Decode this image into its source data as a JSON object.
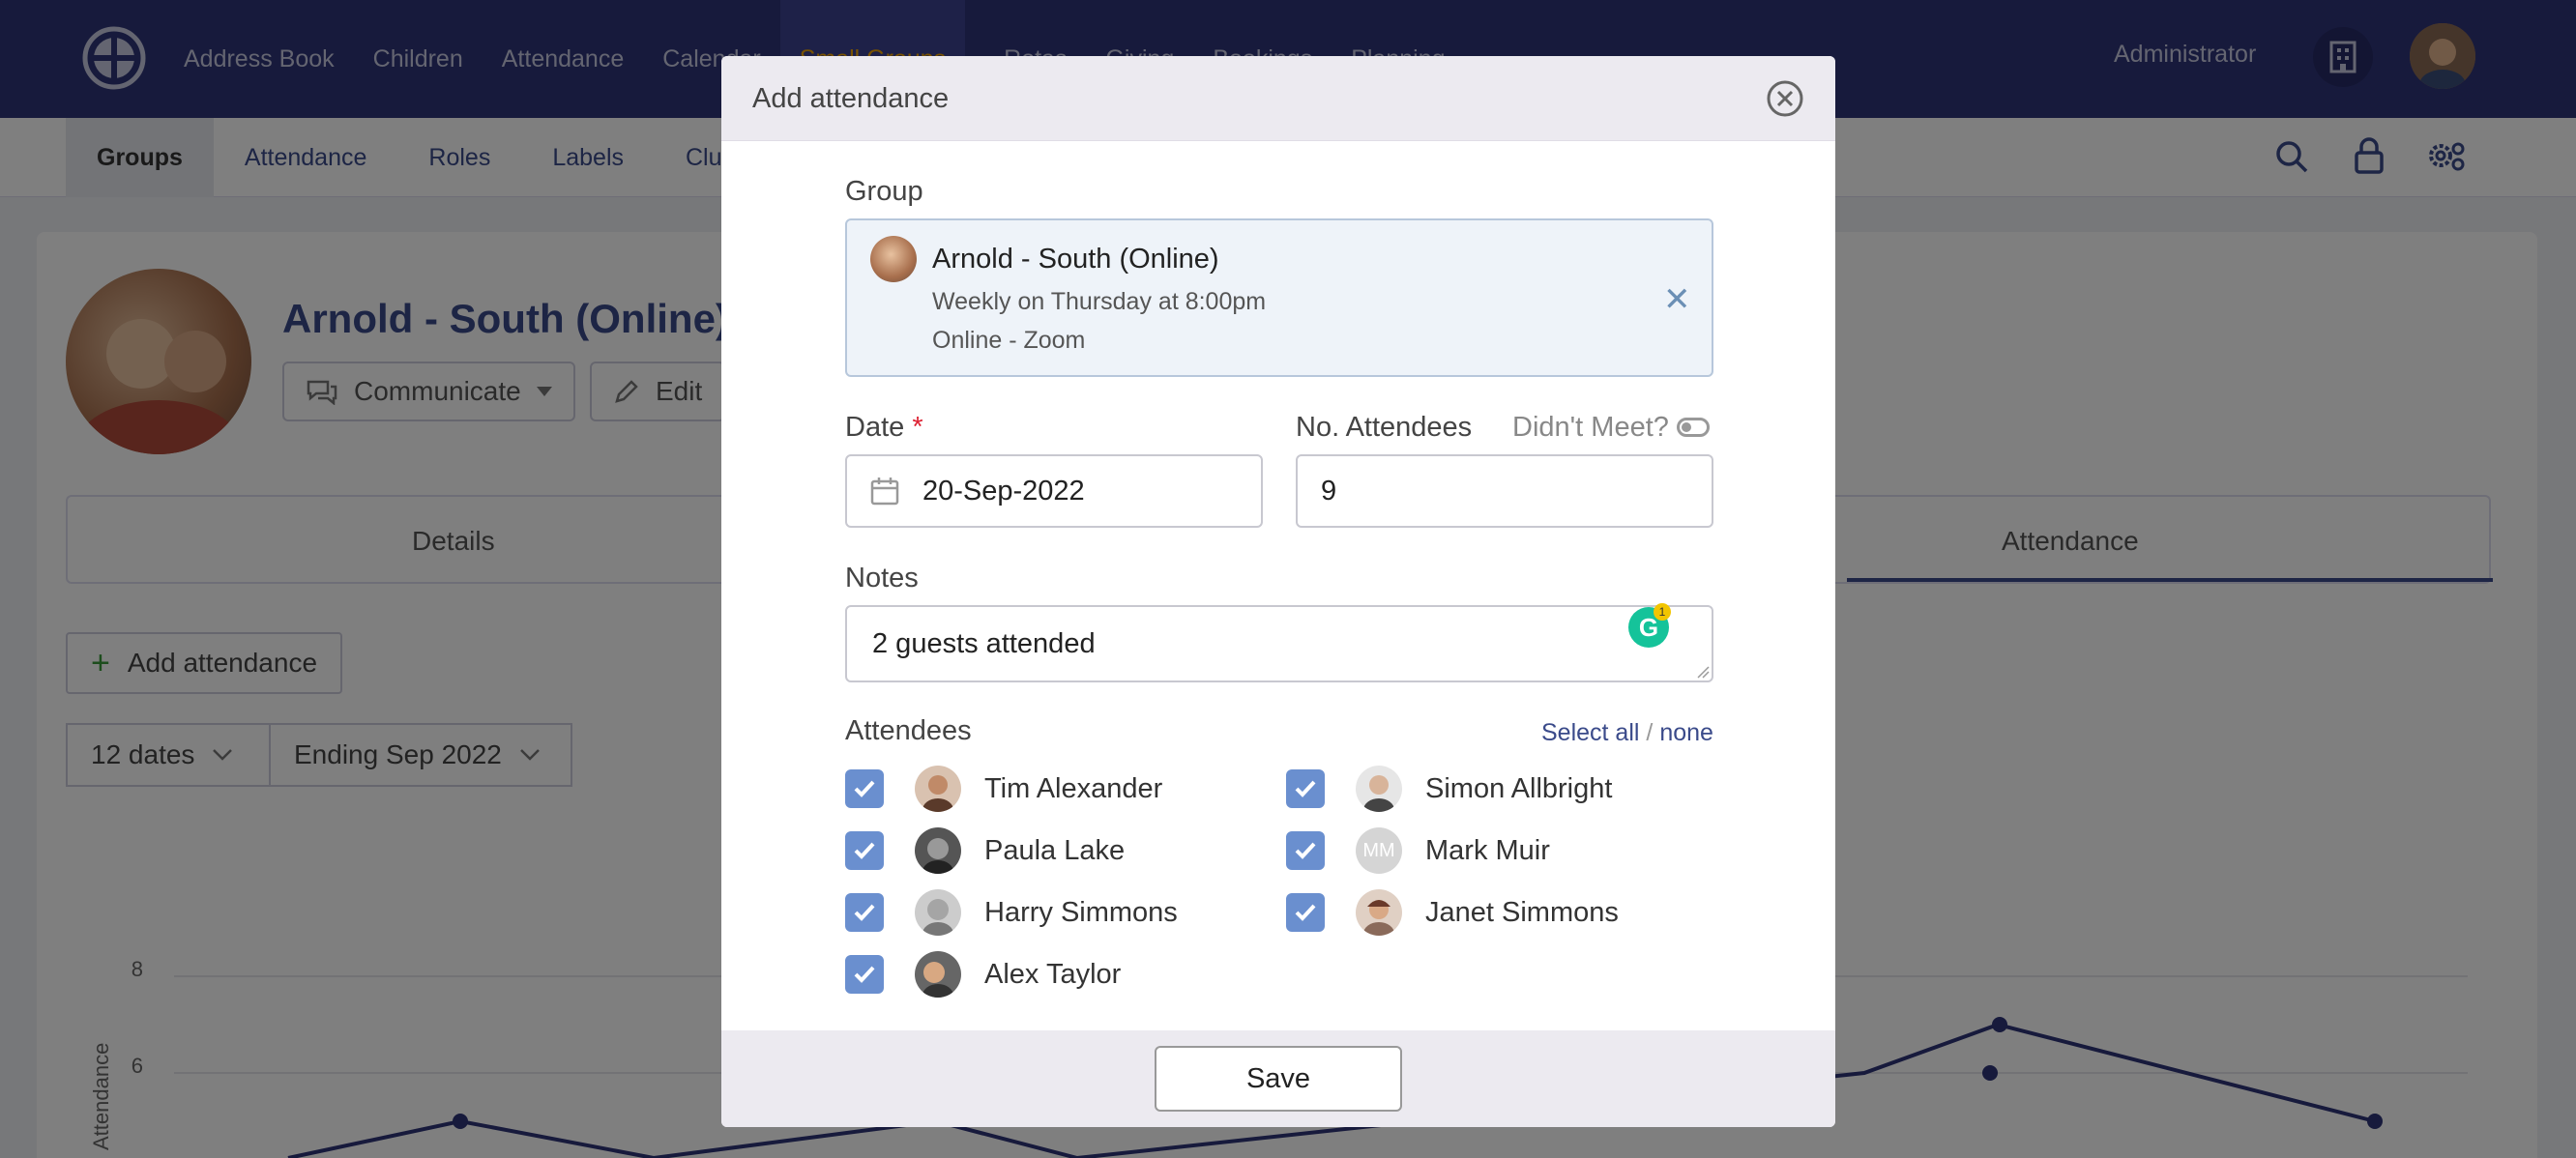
{
  "nav": {
    "items": [
      "Address Book",
      "Children",
      "Attendance",
      "Calendar",
      "Small Groups",
      "Rotas",
      "Giving",
      "Bookings",
      "Planning"
    ],
    "active_index": 4,
    "user_label": "Administrator"
  },
  "subnav": {
    "items": [
      "Groups",
      "Attendance",
      "Roles",
      "Labels",
      "Clusters"
    ],
    "active_index": 0
  },
  "background": {
    "group_title": "Arnold - South (Online)",
    "communicate_label": "Communicate",
    "edit_label": "Edit",
    "tab_details": "Details",
    "tab_attendance": "Attendance",
    "add_attendance_label": "Add attendance",
    "dates_select": "12 dates",
    "ending_select": "Ending Sep 2022",
    "chart_ylabel": "Attendance",
    "chart_ticks": [
      "8",
      "6"
    ]
  },
  "modal": {
    "title": "Add attendance",
    "group_label": "Group",
    "group": {
      "name": "Arnold - South (Online)",
      "schedule": "Weekly on Thursday at 8:00pm",
      "location": "Online - Zoom"
    },
    "date_label": "Date",
    "date_required_mark": "*",
    "date_value": "20-Sep-2022",
    "attendees_count_label": "No. Attendees",
    "attendees_count_value": "9",
    "didnt_meet_label": "Didn't Meet?",
    "notes_label": "Notes",
    "notes_value": "2 guests attended",
    "notes_badge": "1",
    "attendees_label": "Attendees",
    "select_all": "Select all",
    "select_sep": "/",
    "select_none": "none",
    "attendees": [
      {
        "name": "Tim Alexander",
        "checked": true
      },
      {
        "name": "Simon Allbright",
        "checked": true
      },
      {
        "name": "Paula Lake",
        "checked": true
      },
      {
        "name": "Mark Muir",
        "checked": true,
        "initials": "MM"
      },
      {
        "name": "Harry Simmons",
        "checked": true
      },
      {
        "name": "Janet Simmons",
        "checked": true
      },
      {
        "name": "Alex Taylor",
        "checked": true
      }
    ],
    "save_label": "Save"
  },
  "colors": {
    "nav_bg": "#2e3478",
    "accent": "#f0a500",
    "checkbox": "#6a8fcf",
    "link": "#3a4a8a"
  }
}
